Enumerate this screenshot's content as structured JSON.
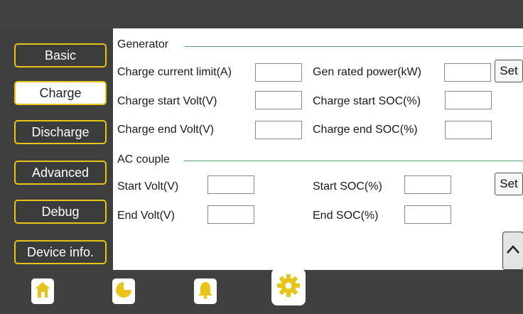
{
  "sidebar": {
    "items": [
      {
        "label": "Basic"
      },
      {
        "label": "Charge"
      },
      {
        "label": "Discharge"
      },
      {
        "label": "Advanced"
      },
      {
        "label": "Debug"
      },
      {
        "label": "Device info."
      }
    ],
    "active": "Charge"
  },
  "generator": {
    "section_label": "Generator",
    "charge_current_limit_label": "Charge current limit(A)",
    "charge_current_limit_value": "",
    "gen_rated_power_label": "Gen rated power(kW)",
    "gen_rated_power_value": "",
    "charge_start_volt_label": "Charge start Volt(V)",
    "charge_start_volt_value": "",
    "charge_start_soc_label": "Charge start SOC(%)",
    "charge_start_soc_value": "",
    "charge_end_volt_label": "Charge end Volt(V)",
    "charge_end_volt_value": "",
    "charge_end_soc_label": "Charge end SOC(%)",
    "charge_end_soc_value": "",
    "set_label": "Set"
  },
  "ac_couple": {
    "section_label": "AC couple",
    "start_volt_label": "Start Volt(V)",
    "start_volt_value": "",
    "start_soc_label": "Start SOC(%)",
    "start_soc_value": "",
    "end_volt_label": "End Volt(V)",
    "end_volt_value": "",
    "end_soc_label": "End SOC(%)",
    "end_soc_value": "",
    "set_label": "Set"
  },
  "bottom_nav": {
    "tabs": [
      {
        "icon": "home-icon"
      },
      {
        "icon": "pie-chart-icon"
      },
      {
        "icon": "bell-icon"
      },
      {
        "icon": "gear-icon"
      }
    ],
    "active": "gear-icon"
  },
  "colors": {
    "accent": "#e7c417",
    "section_line": "#5b9b73",
    "background": "#404040"
  }
}
